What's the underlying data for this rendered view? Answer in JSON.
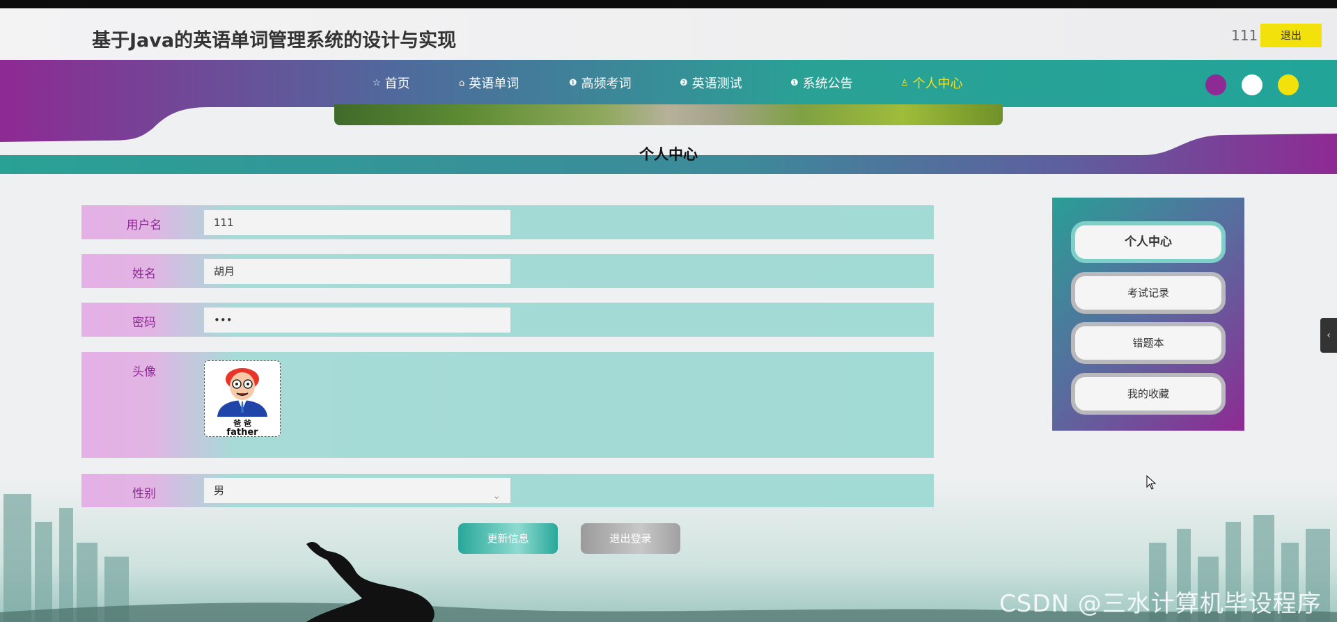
{
  "header": {
    "title": "基于Java的英语单词管理系统的设计与实现",
    "username": "111",
    "logout_label": "退出"
  },
  "nav": {
    "items": [
      {
        "label": "首页",
        "icon": "star-icon",
        "glyph": "☆"
      },
      {
        "label": "英语单词",
        "icon": "bag-icon",
        "glyph": "⌂"
      },
      {
        "label": "高频考词",
        "icon": "alert-circle-icon",
        "glyph": "❶"
      },
      {
        "label": "英语测试",
        "icon": "question-circle-icon",
        "glyph": "❷"
      },
      {
        "label": "系统公告",
        "icon": "info-circle-icon",
        "glyph": "❶"
      },
      {
        "label": "个人中心",
        "icon": "user-icon",
        "glyph": "♙"
      }
    ],
    "active_index": 5,
    "theme_dots": [
      "#8e2a93",
      "#ffffff",
      "#f2e10a"
    ]
  },
  "page": {
    "heading": "个人中心"
  },
  "form": {
    "username_label": "用户名",
    "username_value": "111",
    "name_label": "姓名",
    "name_value": "胡月",
    "password_label": "密码",
    "password_value": "•••",
    "avatar_label": "头像",
    "avatar_caption_cn": "爸 爸",
    "avatar_caption_en": "father",
    "gender_label": "性别",
    "gender_value": "男",
    "update_button": "更新信息",
    "logout_button": "退出登录"
  },
  "sidebar": {
    "items": [
      "个人中心",
      "考试记录",
      "错题本",
      "我的收藏"
    ],
    "active_index": 0
  },
  "watermark": "CSDN @三水计算机毕设程序",
  "colors": {
    "purple": "#8e2a93",
    "teal": "#27a89a",
    "yellow": "#f2e10a",
    "label_purple": "#8d2a93"
  }
}
